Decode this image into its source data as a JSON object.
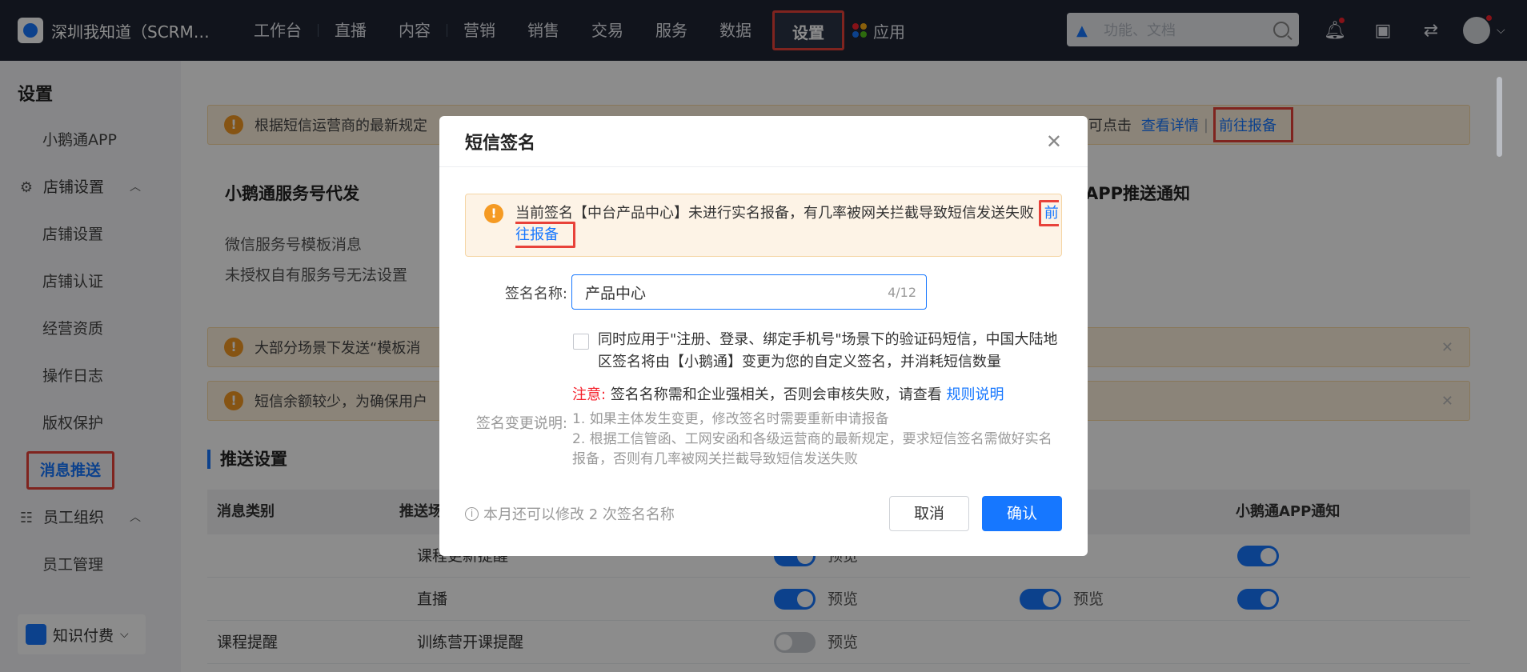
{
  "topbar": {
    "brand": "深圳我知道（SCRM…",
    "nav": [
      "工作台",
      "直播",
      "内容",
      "营销",
      "销售",
      "交易",
      "服务",
      "数据"
    ],
    "nav_active": "设置",
    "nav_apps": "应用",
    "search_placeholder": "功能、文档"
  },
  "sidebar": {
    "title": "设置",
    "items": [
      {
        "label": "小鹅通APP"
      },
      {
        "label": "店铺设置",
        "group": true
      },
      {
        "label": "店铺设置"
      },
      {
        "label": "店铺认证"
      },
      {
        "label": "经营资质"
      },
      {
        "label": "操作日志"
      },
      {
        "label": "版权保护"
      },
      {
        "label": "消息推送",
        "active": true
      },
      {
        "label": "员工组织",
        "group": true
      },
      {
        "label": "员工管理"
      }
    ],
    "bottom_label": "知识付费"
  },
  "main": {
    "banner1_text": "根据短信运营商的最新规定",
    "banner1_tail": "可点击",
    "banner1_link1": "查看详情",
    "banner1_sep": "|",
    "banner1_link2": "前往报备",
    "card1_title": "小鹅通服务号代发",
    "card1_sub": "微信服务号模板消息",
    "card1_desc": "未授权自有服务号无法设置",
    "card2_title": "APP推送通知",
    "banner2_text": "大部分场景下发送“模板消",
    "banner3_text": "短信余额较少，为确保用户",
    "section_title": "推送设置",
    "table_headers": [
      "消息类别",
      "推送场",
      "小鹅通APP通知"
    ],
    "rows": [
      {
        "name": "课程更新提醒",
        "preview": "预览"
      },
      {
        "name": "直播",
        "preview": "预览",
        "preview2": "预览"
      },
      {
        "category": "课程提醒",
        "name": "训练营开课提醒",
        "preview": "预览"
      }
    ]
  },
  "dialog": {
    "title": "短信签名",
    "warn_text": "当前签名【中台产品中心】未进行实名报备，有几率被网关拦截导致短信发送失败",
    "warn_link": "前往报备",
    "name_label": "签名名称:",
    "name_value": "产品中心",
    "name_count": "4/12",
    "checkbox_text": "同时应用于\"注册、登录、绑定手机号\"场景下的验证码短信，中国大陆地区签名将由【小鹅通】变更为您的自定义签名，并消耗短信数量",
    "note_prefix": "注意:",
    "note_text": "签名名称需和企业强相关，否则会审核失败，请查看",
    "note_link": "规则说明",
    "change_label": "签名变更说明:",
    "change_line1": "1. 如果主体发生变更，修改签名时需要重新申请报备",
    "change_line2": "2. 根据工信管函、工网安函和各级运营商的最新规定，要求短信签名需做好实名报备，否则有几率被网关拦截导致短信发送失败",
    "footer_info": "本月还可以修改 2 次签名名称",
    "cancel": "取消",
    "confirm": "确认"
  },
  "colors": {
    "primary": "#1677ff",
    "warn": "#f59a23",
    "highlight": "#e8423a"
  }
}
